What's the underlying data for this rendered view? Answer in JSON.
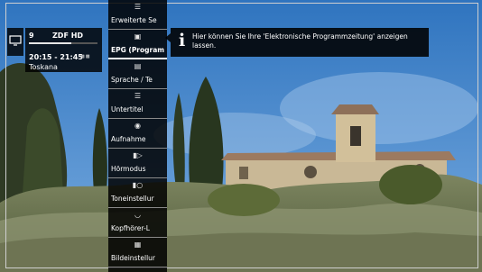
{
  "channel_info": {
    "number": "9",
    "channel_name": "ZDF HD",
    "time_range": "20:15 - 21:45",
    "programme": "Toskana",
    "badges": "  ▣",
    "progress": 0.62
  },
  "menu": {
    "items": [
      {
        "id": "advanced",
        "label": "Erweiterte Se",
        "icon": "list-icon"
      },
      {
        "id": "epg",
        "label": "EPG (Program",
        "icon": "epg-icon",
        "selected": true
      },
      {
        "id": "language",
        "label": "Sprache / Te",
        "icon": "language-list-icon"
      },
      {
        "id": "subtitles",
        "label": "Untertitel",
        "icon": "subtitle-icon"
      },
      {
        "id": "recording",
        "label": "Aufnahme",
        "icon": "record-icon"
      },
      {
        "id": "audio-mode",
        "label": "Hörmodus",
        "icon": "speaker-icon"
      },
      {
        "id": "sound-settings",
        "label": "Toneinstellur",
        "icon": "speaker-settings-icon"
      },
      {
        "id": "headphones",
        "label": "Kopfhörer-L",
        "icon": "headphones-icon"
      },
      {
        "id": "picture-settings",
        "label": "Bildeinstellur",
        "icon": "picture-icon"
      }
    ]
  },
  "info_bubble": {
    "text": "Hier können Sie Ihre 'Elektronische Programmzeitung' anzeigen lassen."
  },
  "colors": {
    "panel_bg": "#000000",
    "text": "#ffffff",
    "sky": "#3e7fc1"
  }
}
